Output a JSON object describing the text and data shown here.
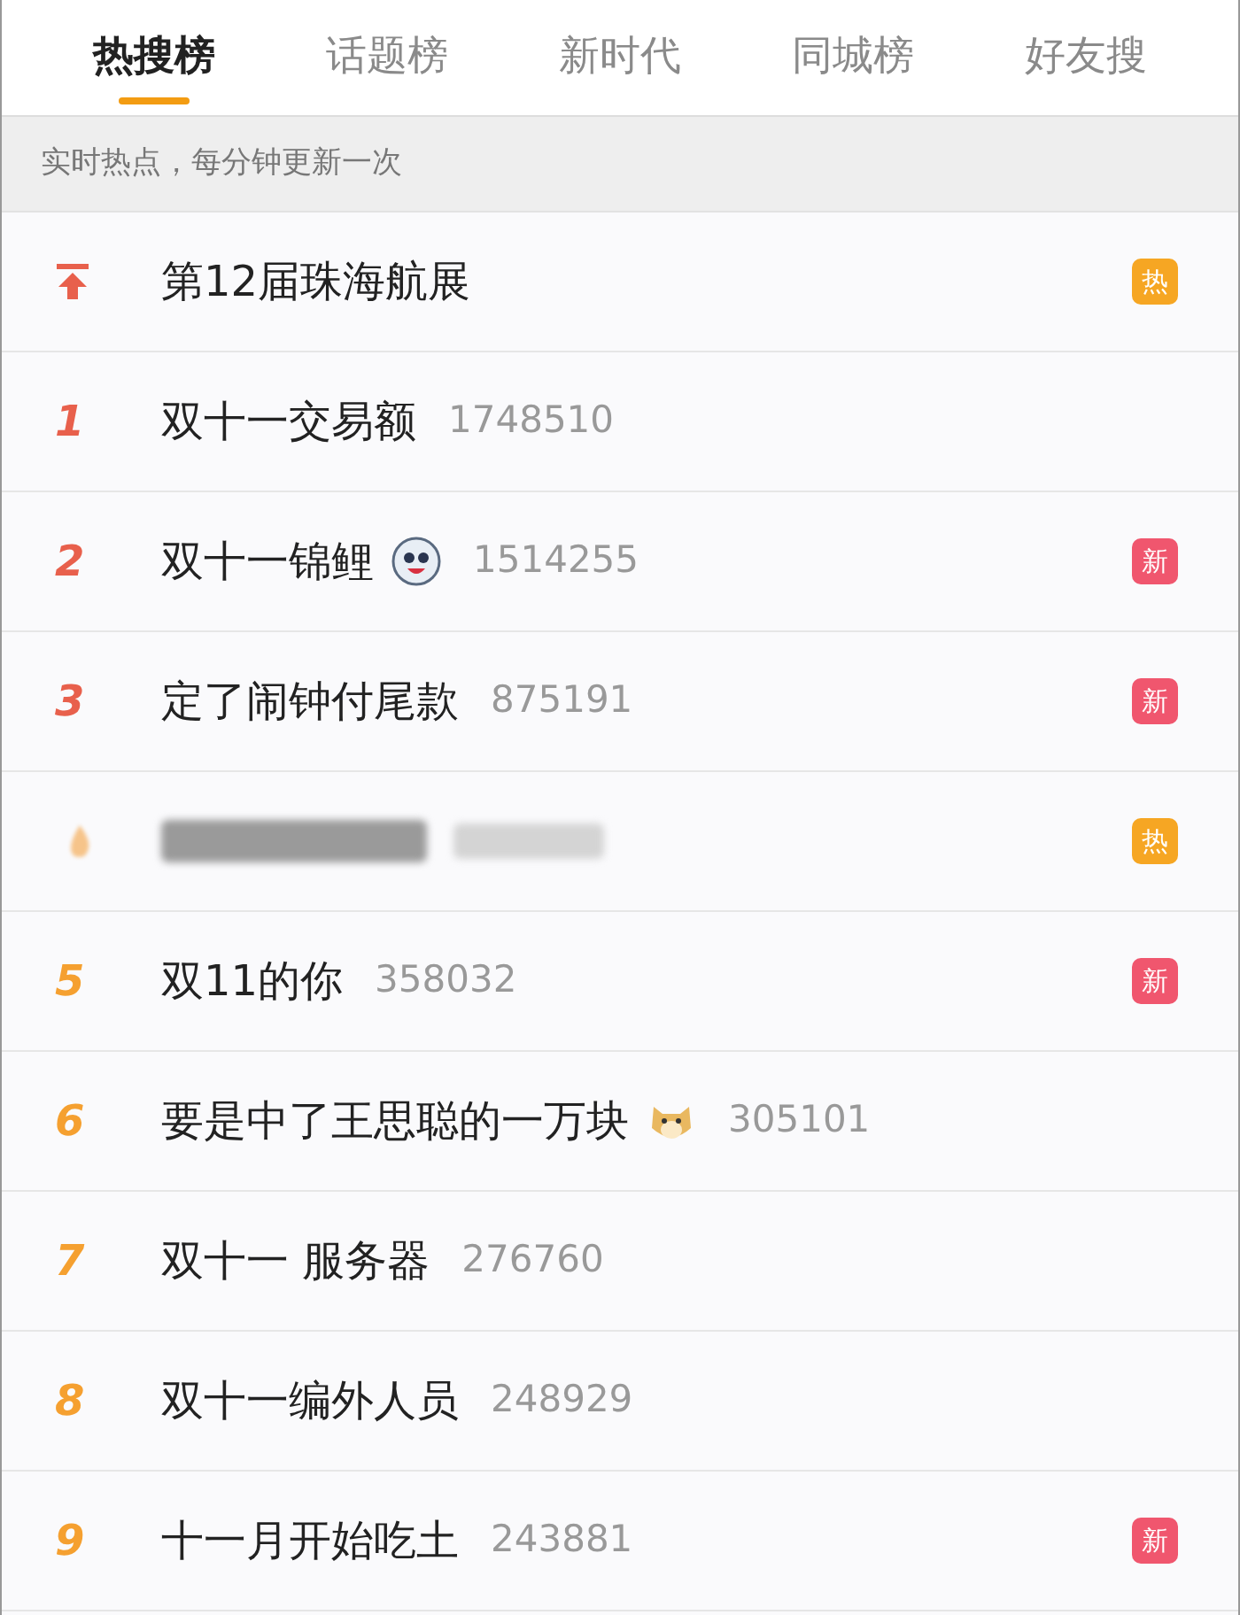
{
  "tabs": [
    {
      "label": "热搜榜",
      "selected": true
    },
    {
      "label": "话题榜",
      "selected": false
    },
    {
      "label": "新时代",
      "selected": false
    },
    {
      "label": "同城榜",
      "selected": false
    },
    {
      "label": "好友搜",
      "selected": false
    }
  ],
  "notice": "实时热点，每分钟更新一次",
  "rows": [
    {
      "kind": "pinned",
      "title": "第12届珠海航展",
      "badge": {
        "kind": "hot",
        "text": "热"
      }
    },
    {
      "kind": "ranked",
      "rank": "1",
      "color": "#e8604c",
      "title": "双十一交易额",
      "count": "1748510"
    },
    {
      "kind": "ranked",
      "rank": "2",
      "color": "#e8604c",
      "title": "双十一锦鲤",
      "emoji": {
        "kind": "panda"
      },
      "count": "1514255",
      "badge": {
        "kind": "new",
        "text": "新"
      }
    },
    {
      "kind": "ranked",
      "rank": "3",
      "color": "#e8604c",
      "title": "定了闹钟付尾款",
      "count": "875191",
      "badge": {
        "kind": "new",
        "text": "新"
      }
    },
    {
      "kind": "blurred",
      "badge": {
        "kind": "hot",
        "text": "热"
      }
    },
    {
      "kind": "ranked",
      "rank": "5",
      "color": "#f5a030",
      "title": "双11的你",
      "count": "358032",
      "badge": {
        "kind": "new",
        "text": "新"
      }
    },
    {
      "kind": "ranked",
      "rank": "6",
      "color": "#f5a030",
      "title": "要是中了王思聪的一万块",
      "emoji": {
        "kind": "dog"
      },
      "count": "305101"
    },
    {
      "kind": "ranked",
      "rank": "7",
      "color": "#f5a030",
      "title": "双十一 服务器",
      "count": "276760"
    },
    {
      "kind": "ranked",
      "rank": "8",
      "color": "#f5a030",
      "title": "双十一编外人员",
      "count": "248929"
    },
    {
      "kind": "ranked",
      "rank": "9",
      "color": "#f5a030",
      "title": "十一月开始吃土",
      "count": "243881",
      "badge": {
        "kind": "new",
        "text": "新"
      }
    }
  ]
}
